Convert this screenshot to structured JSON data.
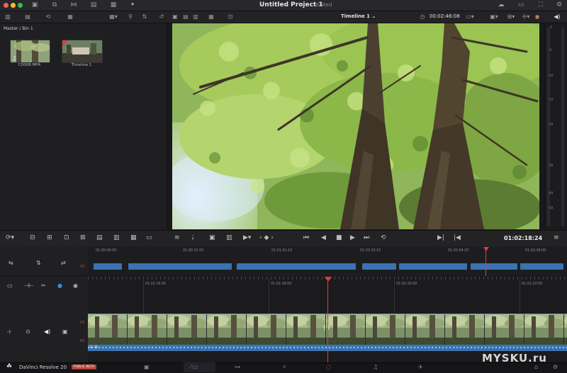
{
  "window": {
    "title": "Untitled Project 1",
    "status": "Edited"
  },
  "toolbar": {
    "timeline_name": "Timeline 1",
    "source_timecode": "00:02:46:08"
  },
  "media_pool": {
    "breadcrumb": "Master / Bin 1",
    "items": [
      {
        "label": "C0008.MP4"
      },
      {
        "label": "Timeline 1"
      }
    ]
  },
  "meter": {
    "labels": [
      "0",
      "-5",
      "-10",
      "-15",
      "-20",
      "-30",
      "-40",
      "-50"
    ]
  },
  "transport": {
    "timecode": "01:02:18:24"
  },
  "upper_timeline": {
    "ruler": [
      "01:00:00:00",
      "01:00:31:55",
      "01:01:02:10",
      "01:01:33:15",
      "01:02:04:20",
      "01:02:36:00"
    ],
    "track_label": "V1"
  },
  "lower_timeline": {
    "ruler": [
      "01:02:16:00",
      "01:02:18:00",
      "01:02:20:00",
      "01:02:22:00"
    ],
    "video_track": "V1",
    "audio_track": "A1"
  },
  "footer": {
    "app_name": "DaVinci Resolve 20",
    "badge": "PUBLIC BETA"
  },
  "watermark": "MYSKU.ru",
  "colors": {
    "clip_blue": "#3a74b0",
    "playhead_red": "#e03a3a",
    "accent_brand": "#b8453a"
  }
}
